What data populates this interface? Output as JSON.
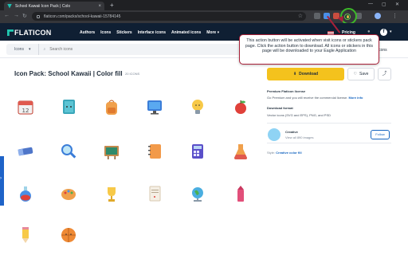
{
  "browser": {
    "tab_title": "School Kawaii Icon Pack | Colo",
    "url": "flaticon.com/packs/school-kawaii-15784145",
    "new_tab": "+",
    "close": "×",
    "win_min": "—",
    "win_max": "▢",
    "win_close": "✕"
  },
  "header": {
    "logo": "FLATICON",
    "nav": [
      "Authors",
      "Icons",
      "Stickers",
      "Interface icons",
      "Animated icons",
      "More"
    ],
    "more_caret": "▾",
    "pricing": "Pricing",
    "avatar_initial": "f"
  },
  "search": {
    "scope": "Icons",
    "scope_caret": "▾",
    "placeholder": "Search icons",
    "right_fragment": "icons"
  },
  "main": {
    "title": "Icon Pack: School Kawaii | Color fill",
    "count": "20 ICONS"
  },
  "sidebar": {
    "download": "Download",
    "save": "Save",
    "share_icon": "share-icon",
    "license_title": "Premium Flaticon license",
    "license_text": "Go Premium and you will receive the commercial license.",
    "license_link": "More info",
    "format_title": "Download format",
    "format_text": "Vector icons (SVG and EPS), PNG, and PSD",
    "author_name": "Creative",
    "author_sub": "View all 890 images",
    "follow": "Follow",
    "style_label": "Style:",
    "style_value": "Creative color fill"
  },
  "popover": {
    "text": "This action button will be activated when visit icons or stickers pack page. Click the action button to download. All icons or stickers in this page will be downloaded to your Eagle Application"
  },
  "icons": [
    {
      "name": "calendar-icon"
    },
    {
      "name": "book-icon"
    },
    {
      "name": "backpack-icon"
    },
    {
      "name": "monitor-icon"
    },
    {
      "name": "lightbulb-icon"
    },
    {
      "name": "apple-icon"
    },
    {
      "name": "eraser-icon"
    },
    {
      "name": "magnifier-icon"
    },
    {
      "name": "chalkboard-icon"
    },
    {
      "name": "notebook-icon"
    },
    {
      "name": "calculator-icon"
    },
    {
      "name": "flask-icon"
    },
    {
      "name": "potion-icon"
    },
    {
      "name": "palette-icon"
    },
    {
      "name": "trophy-icon"
    },
    {
      "name": "paper-icon"
    },
    {
      "name": "globe-icon"
    },
    {
      "name": "crayon-icon"
    },
    {
      "name": "pencil-icon"
    },
    {
      "name": "basketball-icon"
    }
  ]
}
